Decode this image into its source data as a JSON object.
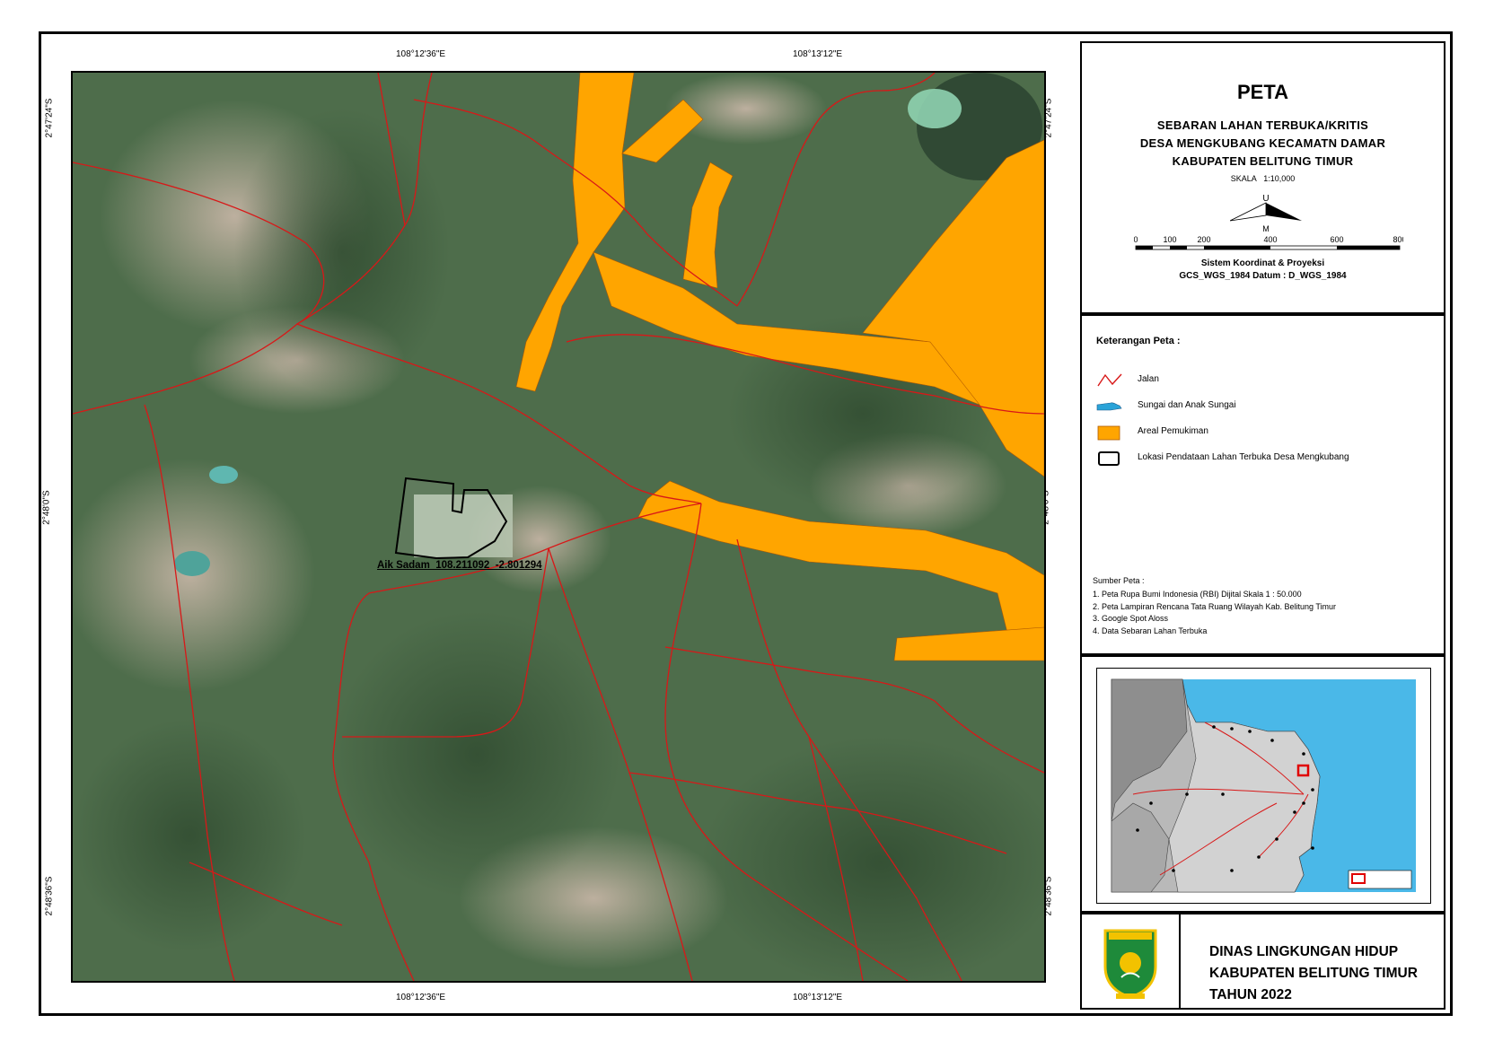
{
  "title": {
    "heading": "PETA",
    "line1": "SEBARAN LAHAN TERBUKA/KRITIS",
    "line2": "DESA MENGKUBANG KECAMATN DAMAR",
    "line3": "KABUPATEN BELITUNG TIMUR",
    "scale_label": "SKALA",
    "scale_value": "1:10,000",
    "north_top": "U",
    "north_bottom": "M",
    "scale_ticks": [
      "0",
      "100",
      "200",
      "400",
      "600",
      "800"
    ],
    "coord_system": "Sistem Koordinat & Proyeksi",
    "datum": "GCS_WGS_1984 Datum : D_WGS_1984"
  },
  "grid": {
    "lon_left": "108°12'36\"E",
    "lon_right": "108°13'12\"E",
    "lat_top": "2°47'24\"S",
    "lat_mid": "2°48'0\"S",
    "lat_bottom": "2°48'36\"S"
  },
  "map": {
    "site_label": "Aik Sadam_108.211092_-2.801294",
    "colors": {
      "imagery": "#4f6e4c",
      "settlement": "#ffa500",
      "road": "#d01010",
      "site_outline": "#000000"
    }
  },
  "legend": {
    "title": "Keterangan Peta :",
    "items": [
      {
        "label": "Jalan",
        "icon": "road-line-icon"
      },
      {
        "label": "Sungai dan Anak Sungai",
        "icon": "river-icon"
      },
      {
        "label": "Areal Pemukiman",
        "icon": "settlement-area-icon"
      },
      {
        "label": "Lokasi Pendataan Lahan Terbuka Desa Mengkubang",
        "icon": "site-outline-icon"
      }
    ]
  },
  "sources": {
    "title": "Sumber Peta :",
    "items": [
      "1. Peta Rupa Bumi Indonesia (RBI) Dijital Skala 1 : 50.000",
      "2. Peta Lampiran Rencana Tata Ruang Wilayah Kab. Belitung Timur",
      "3. Google Spot Aloss",
      "4. Data Sebaran Lahan Terbuka"
    ]
  },
  "org": {
    "line1": "DINAS LINGKUNGAN HIDUP",
    "line2": "KABUPATEN BELITUNG TIMUR",
    "line3": "TAHUN 2022",
    "logo_icon": "belitung-timur-crest-icon"
  }
}
